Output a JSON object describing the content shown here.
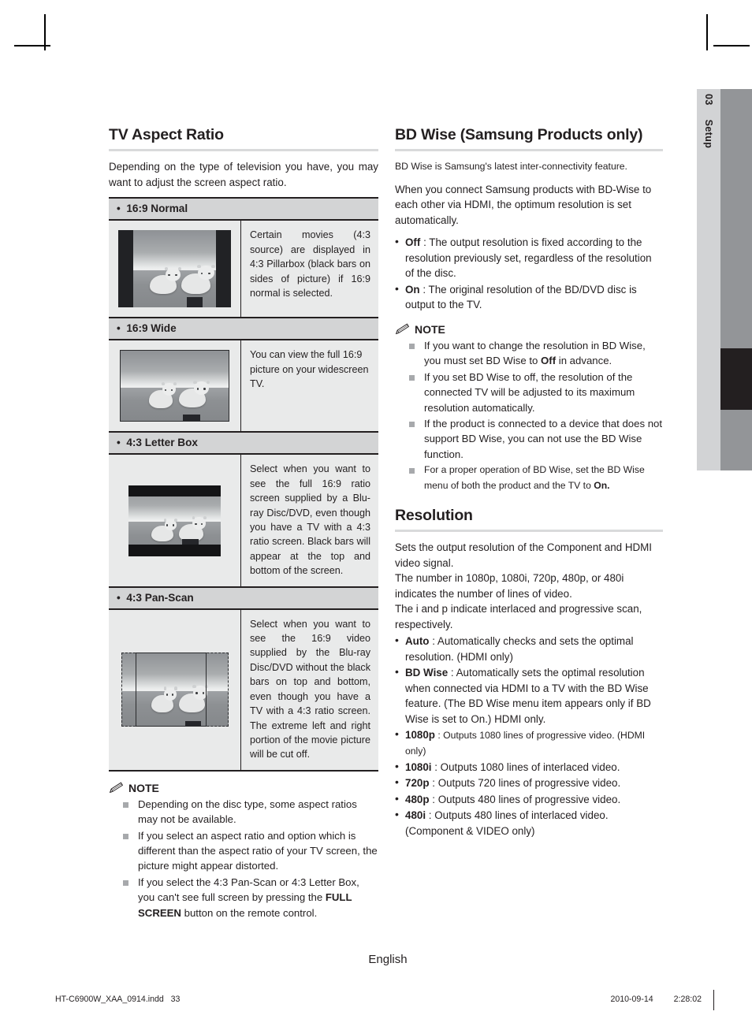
{
  "meta": {
    "language_label": "English"
  },
  "side_tab": {
    "chapter_number": "03",
    "chapter_name": "Setup"
  },
  "left_column": {
    "heading": "TV Aspect Ratio",
    "intro": "Depending on the type of television you have, you may want to adjust the screen aspect ratio.",
    "aspect_table": [
      {
        "label": "16:9 Normal",
        "picture": "tv-pillarbox-puppies-image",
        "description": "Certain movies (4:3 source) are displayed in 4:3 Pillarbox (black bars on sides of picture) if 16:9 normal is selected."
      },
      {
        "label": "16:9 Wide",
        "picture": "tv-widescreen-puppies-image",
        "description": "You can view the full 16:9 picture on your widescreen TV."
      },
      {
        "label": "4:3 Letter Box",
        "picture": "tv-letterbox-puppies-image",
        "description": "Select when you want to see the full 16:9 ratio screen supplied by a Blu-ray Disc/DVD, even though you have a TV with a 4:3 ratio screen. Black bars will appear at the top and bottom of the screen."
      },
      {
        "label": "4:3 Pan-Scan",
        "picture": "tv-panscan-puppies-image",
        "description": "Select when you want to see the 16:9 video supplied by the Blu-ray Disc/DVD without the black bars on top and bottom, even though you have a TV with a 4:3 ratio screen. The extreme left and right portion of the movie picture will be cut off."
      }
    ],
    "note_title": "NOTE",
    "notes": [
      "Depending on the disc type, some aspect ratios may not be available.",
      "If you select an aspect ratio and option which is different than the aspect ratio of your TV screen, the picture might appear distorted.",
      "If you select the 4:3 Pan-Scan or 4:3 Letter Box, you can't see full screen by pressing the FULL SCREEN button on the remote control."
    ],
    "notes_bold_terms": [
      "FULL SCREEN"
    ]
  },
  "right_column": {
    "bdwise": {
      "heading": "BD Wise (Samsung Products only)",
      "intro_1": "BD Wise is Samsung's latest inter-connectivity feature.",
      "intro_2": "When you connect Samsung products with BD-Wise to each other via HDMI, the optimum resolution is set automatically.",
      "options": [
        {
          "term": "Off",
          "text": " : The output resolution is fixed according to the resolution previously set, regardless of the resolution of the disc."
        },
        {
          "term": "On",
          "text": " : The original resolution of the BD/DVD disc is output to the TV."
        }
      ],
      "note_title": "NOTE",
      "notes": [
        "If you want to change the resolution in BD Wise, you must set BD Wise to Off in advance.",
        "If you set BD Wise to off, the resolution of the connected TV will be adjusted to its maximum resolution automatically.",
        "If the product is connected to a device that does not support BD Wise, you can not use the BD Wise function.",
        "For a proper operation of BD Wise, set the BD Wise menu of both the product and the TV to On."
      ]
    },
    "resolution": {
      "heading": "Resolution",
      "intro_1": "Sets the output resolution of the Component and HDMI video signal.",
      "intro_2": "The number in 1080p, 1080i, 720p, 480p, or 480i indicates the number of lines of video.",
      "intro_3": "The i and p indicate interlaced and progressive scan, respectively.",
      "options": [
        {
          "term": "Auto",
          "text": " : Automatically checks and sets the optimal resolution. (HDMI only)",
          "size": "normal"
        },
        {
          "term": "BD Wise",
          "text": " : Automatically sets the optimal resolution when connected via HDMI to a TV with the BD Wise feature. (The BD Wise menu item appears only if BD Wise is set to On.) HDMI only.",
          "size": "normal"
        },
        {
          "term": "1080p",
          "text": " : Outputs 1080 lines of progressive video. (HDMI only)",
          "size": "small"
        },
        {
          "term": "1080i",
          "text": " : Outputs 1080 lines of interlaced video.",
          "size": "normal"
        },
        {
          "term": "720p",
          "text": " : Outputs 720 lines of progressive video.",
          "size": "normal"
        },
        {
          "term": "480p",
          "text": " : Outputs 480 lines of progressive video.",
          "size": "normal"
        },
        {
          "term": "480i",
          "text": " : Outputs 480 lines of interlaced video. (Component & VIDEO only)",
          "size": "normal"
        }
      ]
    }
  },
  "footer": {
    "file_name": "HT-C6900W_XAA_0914.indd",
    "page_number": "33",
    "date": "2010-09-14",
    "time": "2:28:02"
  },
  "colors": {
    "tab_light": "#d2d3d5",
    "tab_bar": "#939598",
    "tab_marker": "#231f20",
    "table_header": "#d3d4d5",
    "table_body": "#e9eaea",
    "rule": "#d9dadb",
    "text": "#231f20",
    "note_bullet": "#a7a9ac"
  }
}
